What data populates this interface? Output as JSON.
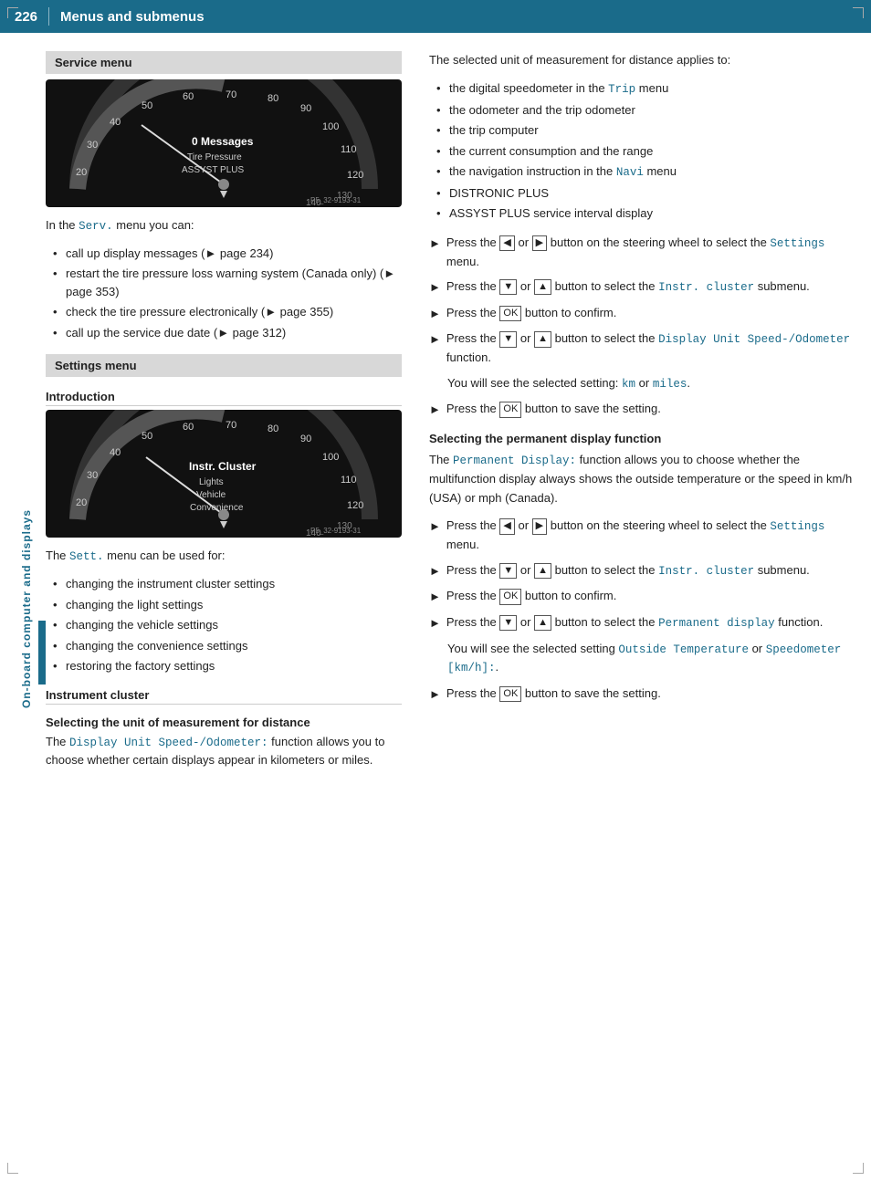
{
  "header": {
    "page_number": "226",
    "title": "Menus and submenus"
  },
  "sidebar": {
    "label": "On-board computer and displays"
  },
  "left_column": {
    "service_menu": {
      "title": "Service menu",
      "intro": "In the",
      "intro_code": "Serv.",
      "intro_rest": " menu you can:",
      "bullets": [
        {
          "text": "call up display messages (",
          "suffix": " page 234)",
          "has_arrow": true
        },
        {
          "text": "restart the tire pressure loss warning system (Canada only) (",
          "suffix": " page 353)",
          "has_arrow": true
        },
        {
          "text": "check the tire pressure electronically (",
          "suffix": " page 355)",
          "has_arrow": true
        },
        {
          "text": "call up the service due date (",
          "suffix": " page 312)",
          "has_arrow": true
        }
      ]
    },
    "settings_menu": {
      "title": "Settings menu",
      "subsection": "Introduction",
      "intro_text": "The",
      "intro_code": "Sett.",
      "intro_rest": " menu can be used for:",
      "bullets": [
        "changing the instrument cluster settings",
        "changing the light settings",
        "changing the vehicle settings",
        "changing the convenience settings",
        "restoring the factory settings"
      ],
      "instrument_cluster": {
        "title": "Instrument cluster",
        "sub_title": "Selecting the unit of measurement for distance",
        "intro": "The",
        "intro_code": "Display Unit Speed-/Odometer:",
        "intro_rest": " function allows you to choose whether certain displays appear in kilometers or miles."
      }
    }
  },
  "right_column": {
    "measurement_intro": "The selected unit of measurement for distance applies to:",
    "bullets": [
      {
        "text": "the digital speedometer in the ",
        "code": "Trip",
        "suffix": " menu"
      },
      {
        "text": "the odometer and the trip odometer"
      },
      {
        "text": "the trip computer"
      },
      {
        "text": "the current consumption and the range"
      },
      {
        "text": "the navigation instruction in the ",
        "code": "Navi",
        "suffix": " menu"
      },
      {
        "text": "DISTRONIC PLUS"
      },
      {
        "text": "ASSYST PLUS service interval display"
      }
    ],
    "steps_group1": [
      {
        "text_prefix": "Press the ",
        "btn1": "◄",
        "text_mid": " or ",
        "btn2": "►",
        "text_suffix": " button on the steering wheel to select the ",
        "code": "Settings",
        "text_end": " menu."
      },
      {
        "text_prefix": "Press the ",
        "btn1": "▼",
        "text_mid": " or ",
        "btn2": "▲",
        "text_suffix": " button to select the ",
        "code": "Instr. cluster",
        "text_end": " submenu."
      },
      {
        "text_prefix": "Press the ",
        "ok": "OK",
        "text_suffix": " button to confirm."
      },
      {
        "text_prefix": "Press the ",
        "btn1": "▼",
        "text_mid": " or ",
        "btn2": "▲",
        "text_suffix": " button to select the ",
        "code": "Display Unit Speed-/Odometer",
        "text_end": " function."
      }
    ],
    "step_note1": "You will see the selected setting: ",
    "step_note1_code1": "km",
    "step_note1_mid": " or ",
    "step_note1_code2": "miles",
    "step_note1_end": ".",
    "step_final1": {
      "text_prefix": "Press the ",
      "ok": "OK",
      "text_suffix": " button to save the setting."
    },
    "permanent_display": {
      "title": "Selecting the permanent display function",
      "intro": "The ",
      "intro_code": "Permanent Display:",
      "intro_rest": " function allows you to choose whether the multifunction display always shows the outside temperature or the speed in km/h (USA) or mph (Canada)."
    },
    "steps_group2": [
      {
        "text_prefix": "Press the ",
        "btn1": "◄",
        "text_mid": " or ",
        "btn2": "►",
        "text_suffix": " button on the steering wheel to select the ",
        "code": "Settings",
        "text_end": " menu."
      },
      {
        "text_prefix": "Press the ",
        "btn1": "▼",
        "text_mid": " or ",
        "btn2": "▲",
        "text_suffix": " button to select the ",
        "code": "Instr. cluster",
        "text_end": " submenu."
      },
      {
        "text_prefix": "Press the ",
        "ok": "OK",
        "text_suffix": " button to confirm."
      },
      {
        "text_prefix": "Press the ",
        "btn1": "▼",
        "text_mid": " or ",
        "btn2": "▲",
        "text_suffix": " button to select the ",
        "code": "Permanent display",
        "text_end": " function."
      }
    ],
    "step_note2_prefix": "You will see the selected setting ",
    "step_note2_code1": "Outside Temperature",
    "step_note2_mid": " or ",
    "step_note2_code2": "Speedometer [km/h]:",
    "step_note2_end": ".",
    "step_final2": {
      "text_prefix": "Press the ",
      "ok": "OK",
      "text_suffix": " button to save the setting."
    }
  }
}
